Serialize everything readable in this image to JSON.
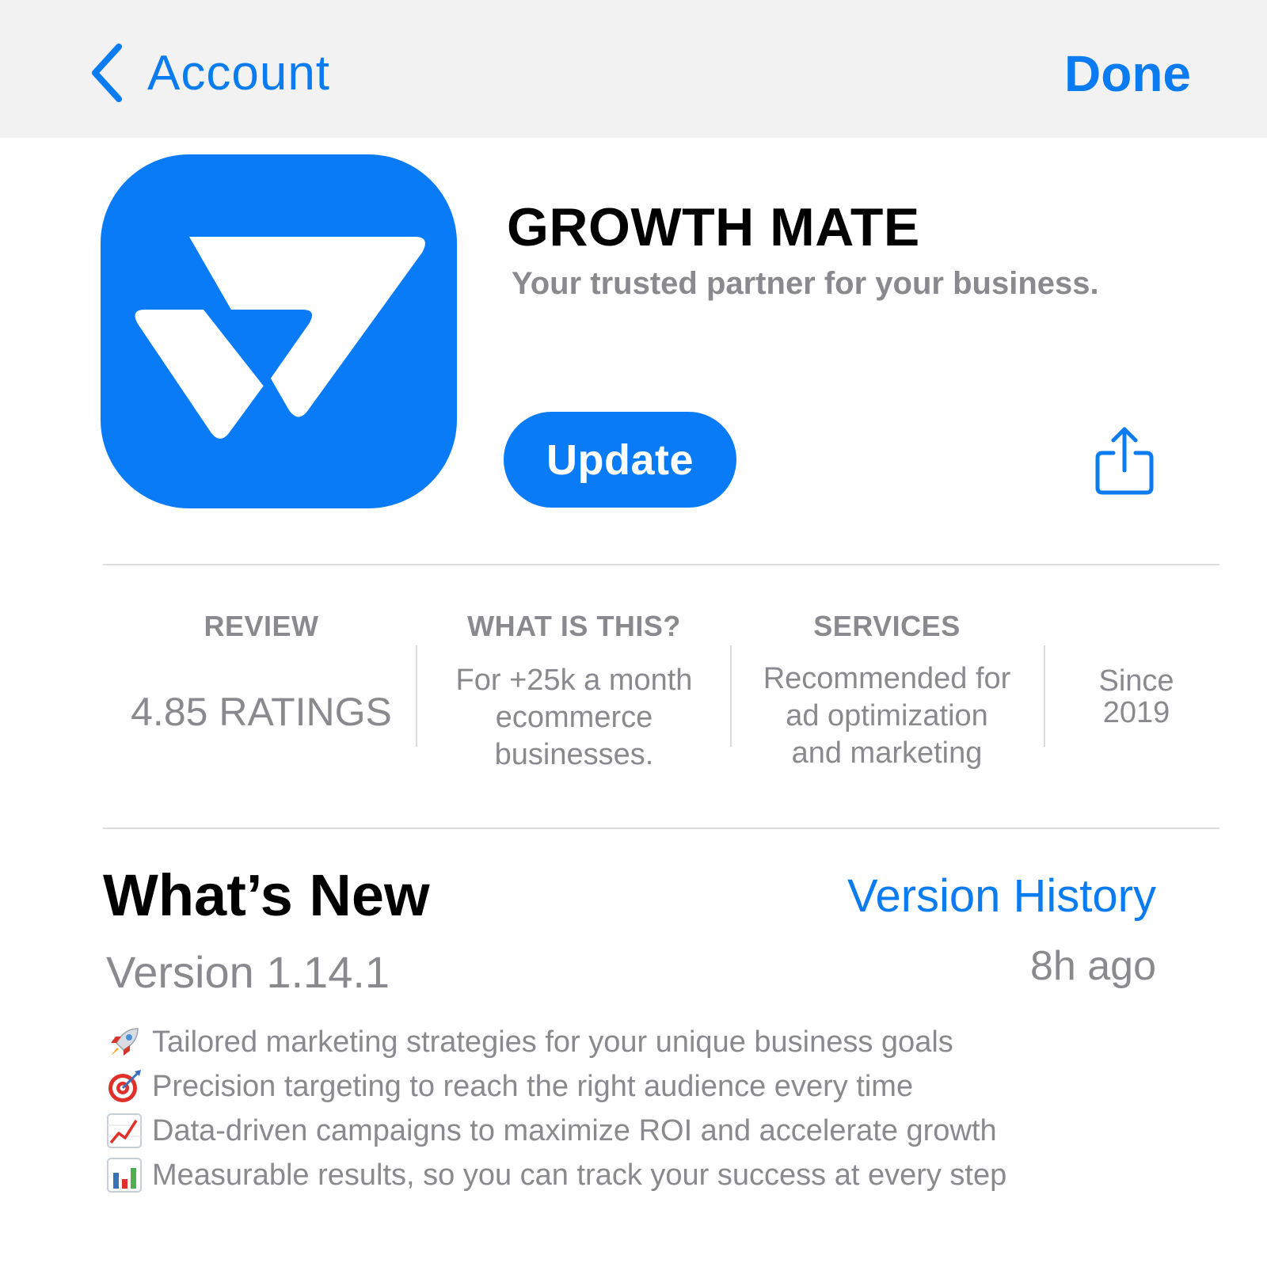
{
  "nav": {
    "back_label": "Account",
    "done_label": "Done"
  },
  "app": {
    "name": "GROWTH MATE",
    "tagline": "Your trusted partner for your business.",
    "update_label": "Update"
  },
  "info": {
    "review_header": "REVIEW",
    "review_value": "4.85 RATINGS",
    "what_header": "WHAT IS THIS?",
    "what_lines": [
      "For +25k a month",
      "ecommerce",
      "businesses."
    ],
    "services_header": "SERVICES",
    "services_lines": [
      "Recommended for",
      "ad optimization",
      "and marketing"
    ],
    "since_lines": [
      "Since",
      "2019"
    ]
  },
  "whats_new": {
    "title": "What’s New",
    "history_link": "Version History",
    "version": "Version 1.14.1",
    "age": "8h ago",
    "notes": [
      {
        "icon": "rocket-icon",
        "text": "Tailored marketing strategies for your unique business goals"
      },
      {
        "icon": "target-icon",
        "text": "Precision targeting to reach the right audience every time"
      },
      {
        "icon": "chart-up-icon",
        "text": "Data-driven campaigns to maximize ROI and accelerate growth"
      },
      {
        "icon": "bar-chart-icon",
        "text": "Measurable results, so you can track your success at every step"
      }
    ]
  },
  "colors": {
    "accent": "#0a7bf0",
    "icon_bg": "#0a7bf7",
    "secondary_text": "#8a8a8e",
    "nav_bg": "#f2f2f2"
  }
}
